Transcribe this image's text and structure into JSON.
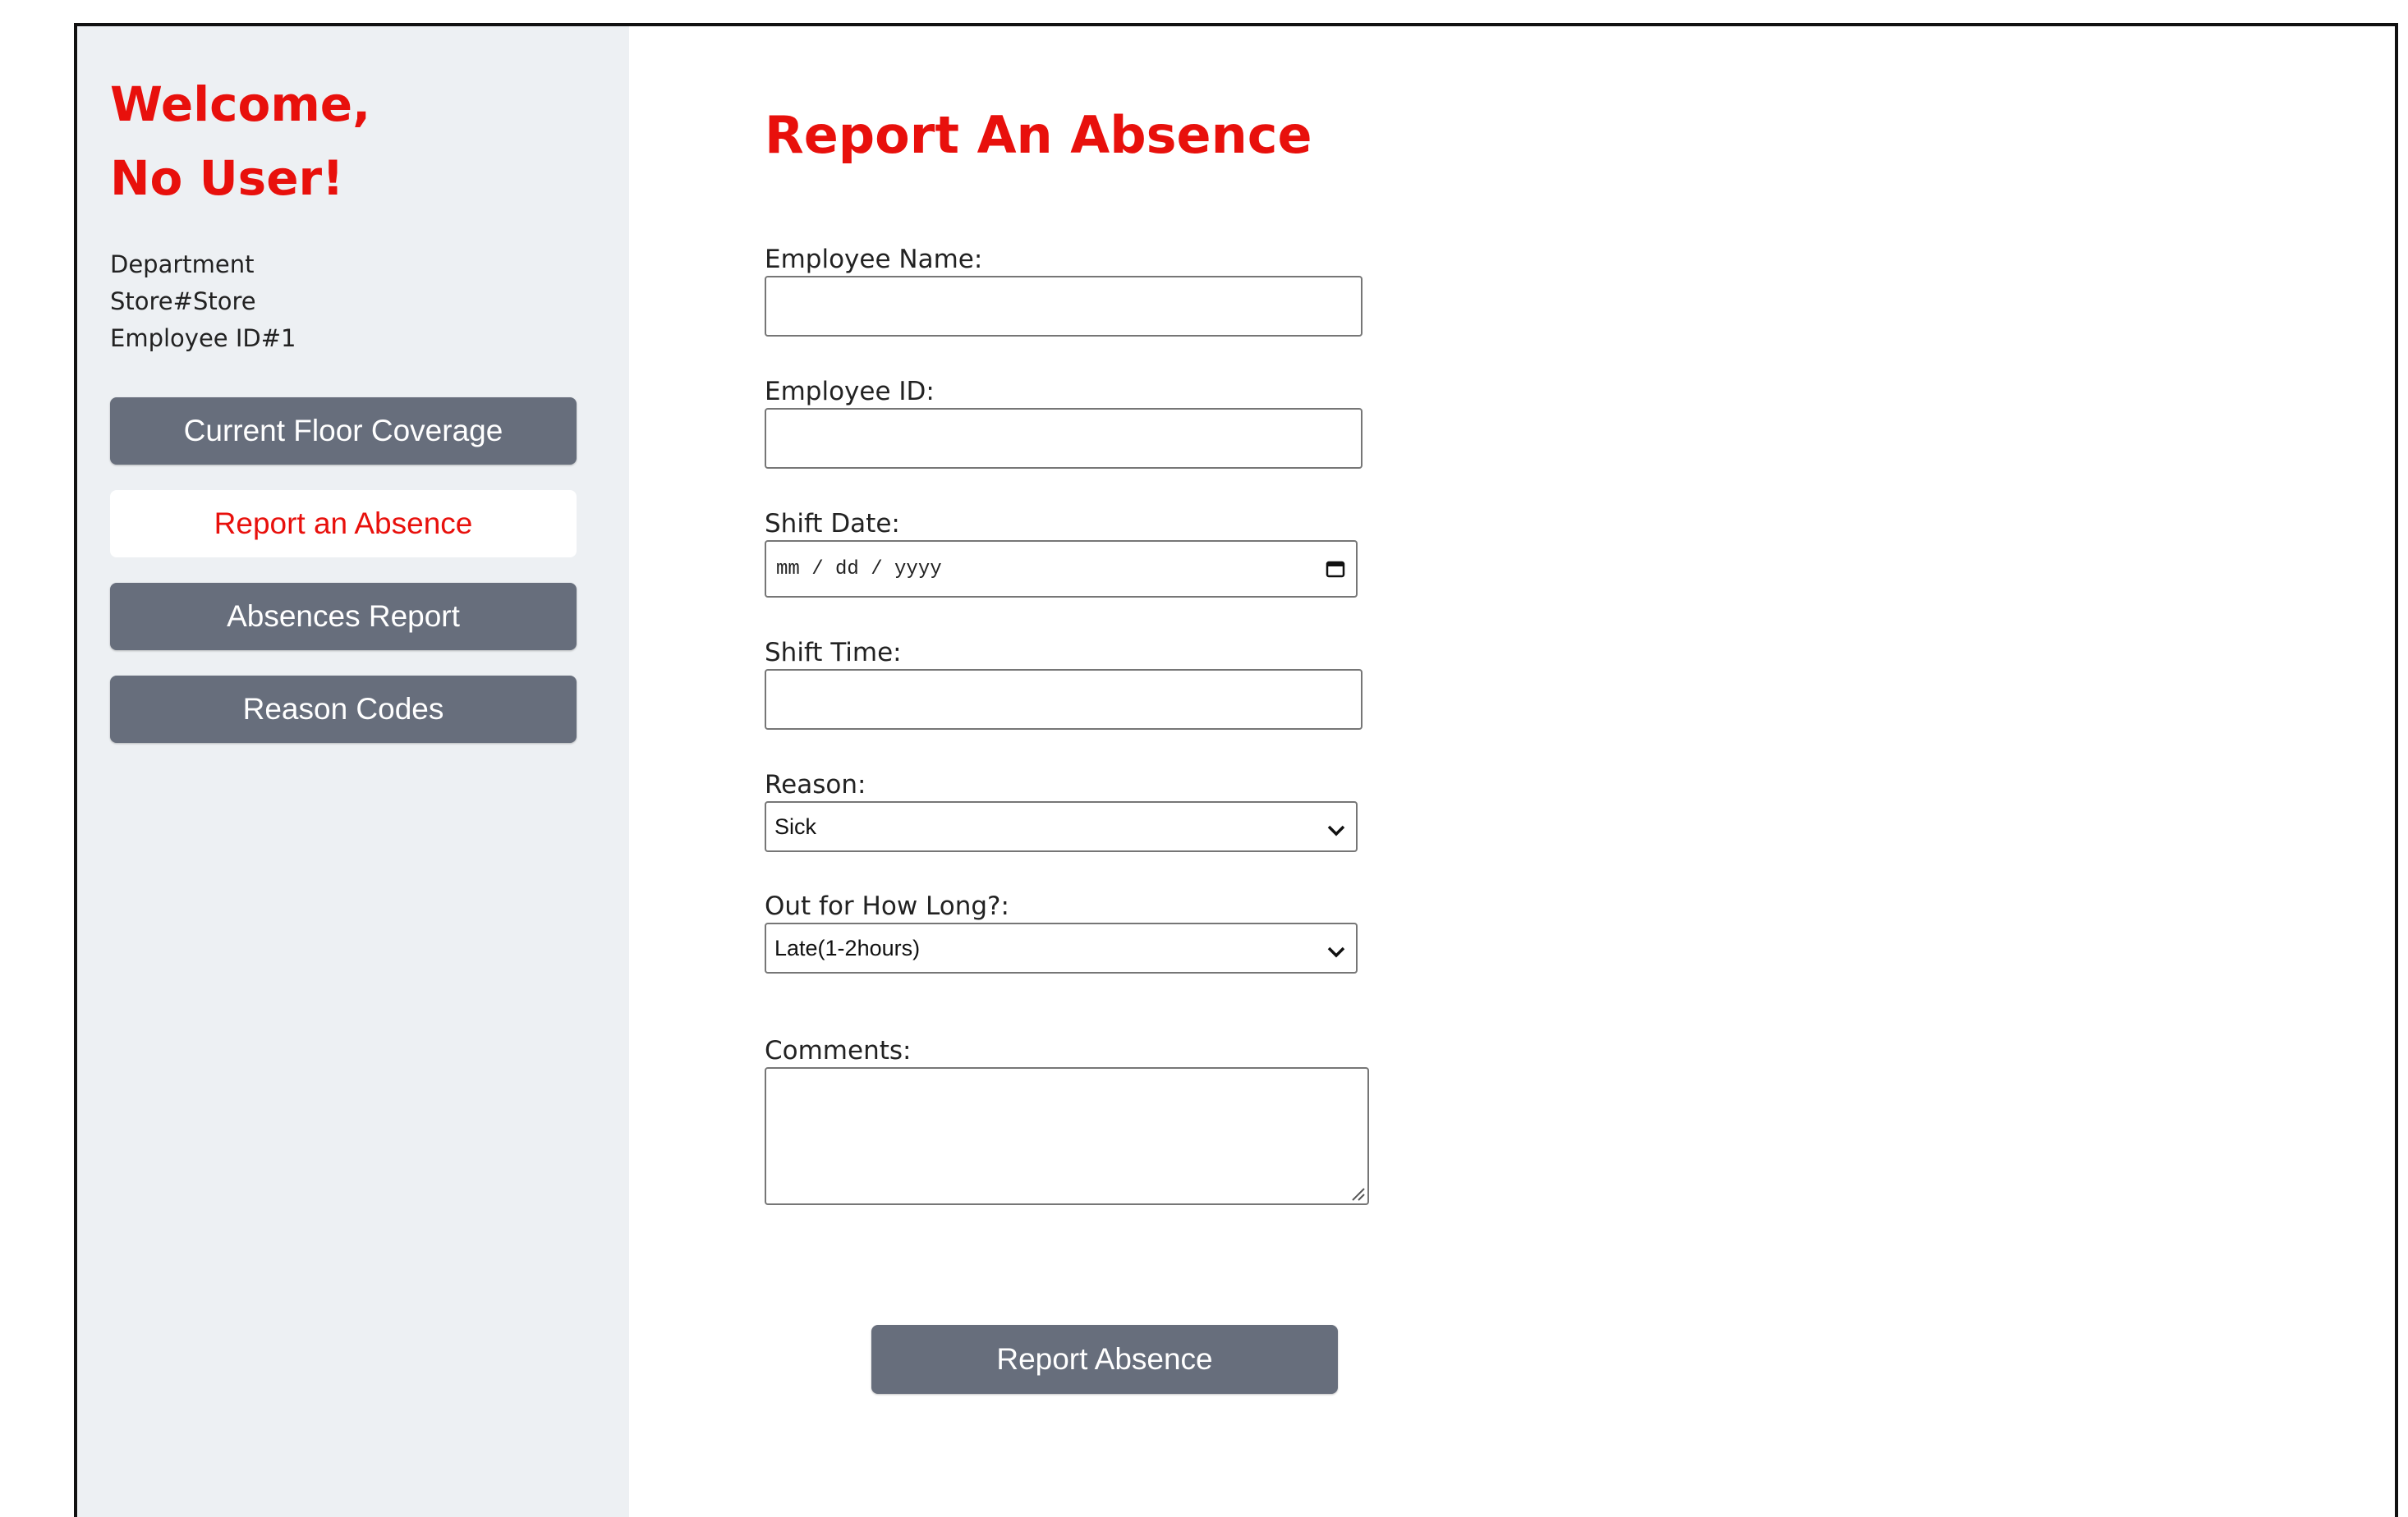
{
  "sidebar": {
    "welcome_line1": "Welcome,",
    "welcome_line2": "No User!",
    "department": "Department",
    "store": "Store#Store",
    "employee_id": "Employee ID#1",
    "nav": [
      {
        "label": "Current Floor Coverage",
        "active": false
      },
      {
        "label": "Report an Absence",
        "active": true
      },
      {
        "label": "Absences Report",
        "active": false
      },
      {
        "label": "Reason Codes",
        "active": false
      }
    ]
  },
  "main": {
    "title": "Report An Absence",
    "form": {
      "employee_name": {
        "label": "Employee Name:",
        "value": ""
      },
      "employee_id": {
        "label": "Employee ID:",
        "value": ""
      },
      "shift_date": {
        "label": "Shift Date:",
        "placeholder": "mm / dd / yyyy"
      },
      "shift_time": {
        "label": "Shift Time:",
        "value": ""
      },
      "reason": {
        "label": "Reason:",
        "selected": "Sick"
      },
      "duration": {
        "label": "Out for How Long?:",
        "selected": "Late(1-2hours)"
      },
      "comments": {
        "label": "Comments:",
        "value": ""
      }
    },
    "submit_label": "Report Absence"
  },
  "colors": {
    "accent_red": "#e8100c",
    "button_gray": "#676e7c",
    "sidebar_bg": "#edf0f3"
  },
  "icons": {
    "date_picker": "calendar-icon",
    "select": "chevron-down-icon",
    "textarea_resize": "resize-grip-icon"
  }
}
